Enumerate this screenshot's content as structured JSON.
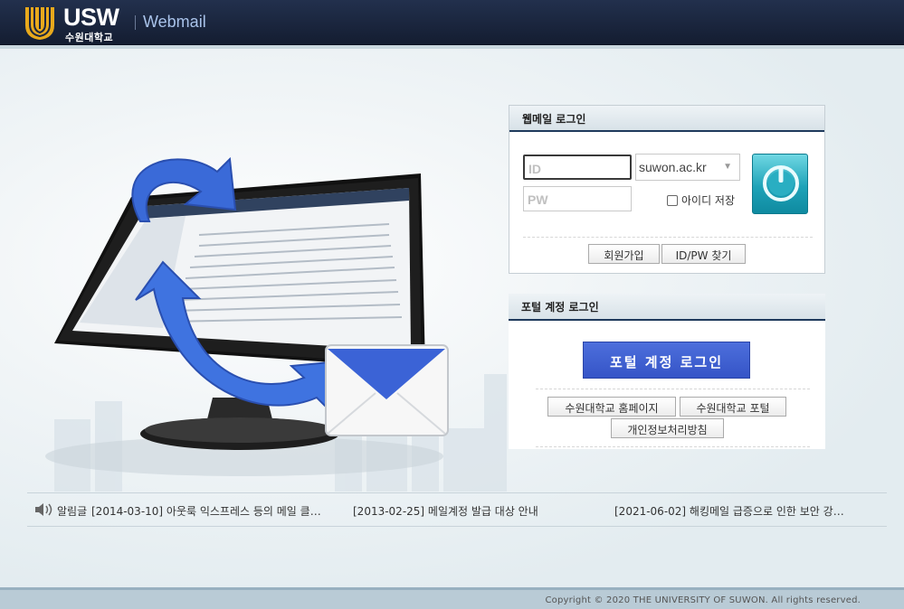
{
  "header": {
    "logo_text": "USW",
    "logo_subtext": "수원대학교",
    "title": "Webmail"
  },
  "webmail_login": {
    "title": "웹메일 로그인",
    "id_placeholder": "ID",
    "pw_placeholder": "PW",
    "domain_selected": "suwon.ac.kr",
    "save_id_label": "아이디 저장",
    "join_label": "회원가입",
    "find_label": "ID/PW 찾기"
  },
  "portal_login": {
    "title": "포털 계정 로그인",
    "button_label": "포털 계정 로그인",
    "homepage_label": "수원대학교 홈페이지",
    "portal_label": "수원대학교 포털",
    "privacy_label": "개인정보처리방침"
  },
  "notices": {
    "prefix": "알림글",
    "items": [
      "[2014-03-10] 아웃룩 익스프레스 등의 메일 클…",
      "[2013-02-25] 메일계정 발급 대상 안내",
      "[2021-06-02] 해킹메일 급증으로 인한 보안 강…"
    ]
  },
  "footer": {
    "copyright": "Copyright © 2020 THE UNIVERSITY OF SUWON. All rights reserved."
  },
  "colors": {
    "header_bg": "#1a2540",
    "header_title": "#a9c3ea",
    "panel_underline": "#1f3a5c",
    "portal_button": "#3f5fd3",
    "login_button": "#1ea3b8",
    "footer_bg": "#b9cbd6"
  },
  "icons": {
    "logo": "usw-shield-logo",
    "power": "power-icon",
    "speaker": "speaker-icon",
    "envelope": "envelope-icon",
    "refresh_arrow": "refresh-arrow-icon"
  }
}
